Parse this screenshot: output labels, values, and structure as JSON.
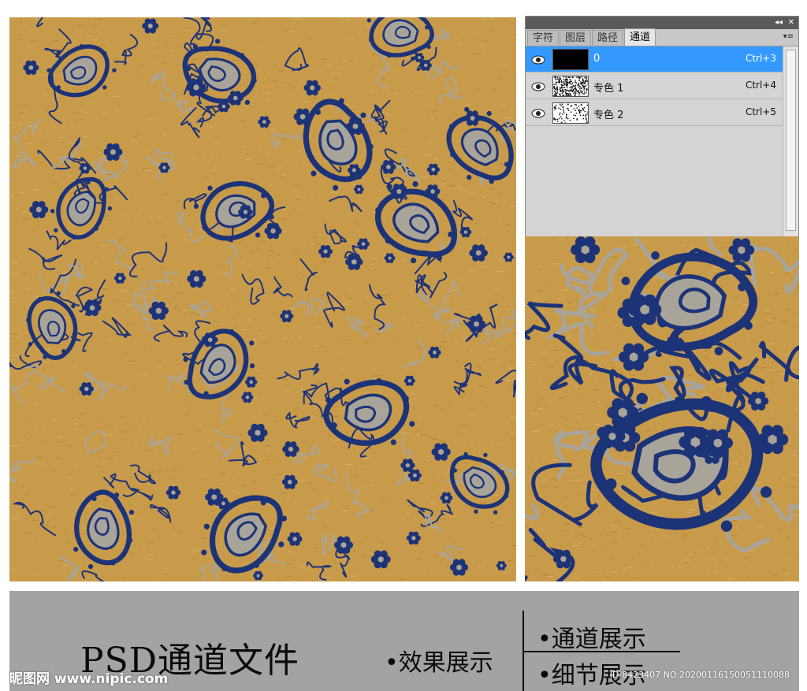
{
  "panel": {
    "tabs": [
      {
        "label": "字符"
      },
      {
        "label": "图层"
      },
      {
        "label": "路径"
      },
      {
        "label": "通道"
      }
    ],
    "titlebar": {
      "collapse_icon": "double-chevron-icon",
      "close_icon": "close-icon",
      "collapse_glyph": "◂◂",
      "close_glyph": "✕"
    },
    "menu_icon": "panel-menu-icon",
    "channels": [
      {
        "name": "0",
        "shortcut": "Ctrl+3",
        "selected": true
      },
      {
        "name": "专色 1",
        "shortcut": "Ctrl+4",
        "selected": false
      },
      {
        "name": "专色 2",
        "shortcut": "Ctrl+5",
        "selected": false
      }
    ]
  },
  "colors": {
    "fabric_gold": "#c89b4b",
    "paisley_blue": "#1d3378",
    "highlight_gray": "#a8a49a",
    "selection_blue": "#3399ff",
    "footer_gray": "#a3a3a3"
  },
  "footer": {
    "title": "PSD通道文件",
    "effect": "•效果展示",
    "channel_show": "•通道展示",
    "detail_show": "•细节展示"
  },
  "watermark": {
    "logo": "昵图网 www.nipic.com",
    "id_text": "ID:8423407 NO:20200116150051110088"
  }
}
